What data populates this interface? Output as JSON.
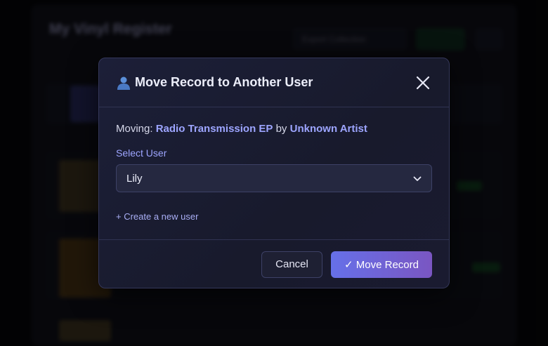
{
  "background": {
    "app_title": "My Vinyl Register",
    "subtitle": "",
    "export_button": "Export Collection"
  },
  "modal": {
    "title": "Move Record to Another User",
    "title_icon": "user-icon",
    "close_icon": "close-icon",
    "moving_prefix": "Moving:",
    "record_title": "Radio Transmission EP",
    "by_word": "by",
    "artist": "Unknown Artist",
    "select_label": "Select User",
    "selected_user": "Lily",
    "create_user_link": "+ Create a new user",
    "cancel_label": "Cancel",
    "move_label": "✓ Move Record"
  },
  "colors": {
    "accent": "#9da5ff",
    "button_gradient_start": "#6670e8",
    "button_gradient_end": "#7a56c2"
  }
}
